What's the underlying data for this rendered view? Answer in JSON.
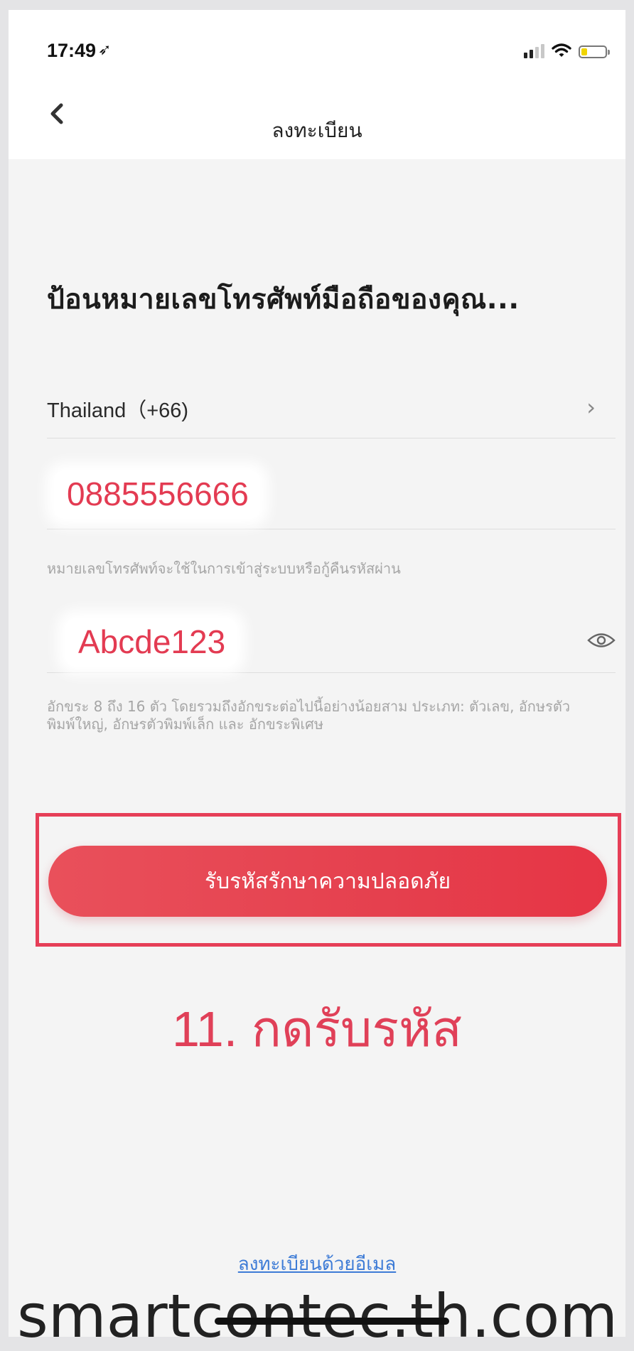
{
  "status_bar": {
    "time": "17:49",
    "location_glyph": "➶",
    "signal_bars_active": 2,
    "signal_bars_total": 4,
    "battery_level": 0.25,
    "battery_color": "#f0d400"
  },
  "nav": {
    "title": "ลงทะเบียน",
    "back_icon": "chevron-left-icon"
  },
  "form": {
    "heading": "ป้อนหมายเลขโทรศัพท์มือถือของคุณ...",
    "country": {
      "label": "Thailand（+66)",
      "chevron": "›"
    },
    "phone": {
      "value": "0885556666",
      "hint": "หมายเลขโทรศัพท์จะใช้ในการเข้าสู่ระบบหรือกู้คืนรหัสผ่าน"
    },
    "password": {
      "value": "Abcde123",
      "hint": "อักขระ 8 ถึง 16 ตัว โดยรวมถึงอักขระต่อไปนี้อย่างน้อยสาม ประเภท: ตัวเลข, อักษรตัวพิมพ์ใหญ่, อักษรตัวพิมพ์เล็ก และ อักขระพิเศษ",
      "toggle_icon": "eye-icon"
    },
    "submit_label": "รับรหัสรักษาความปลอดภัย"
  },
  "annotation": {
    "step_label": "11. กดรับรหัส",
    "highlight_color": "#e63e57"
  },
  "footer": {
    "email_link": "ลงทะเบียนด้วยอีเมล"
  },
  "watermark": {
    "text": "smartcontec.th.com"
  },
  "colors": {
    "accent": "#e5404e",
    "link": "#3d7bd6",
    "field_text": "#e33b52"
  }
}
